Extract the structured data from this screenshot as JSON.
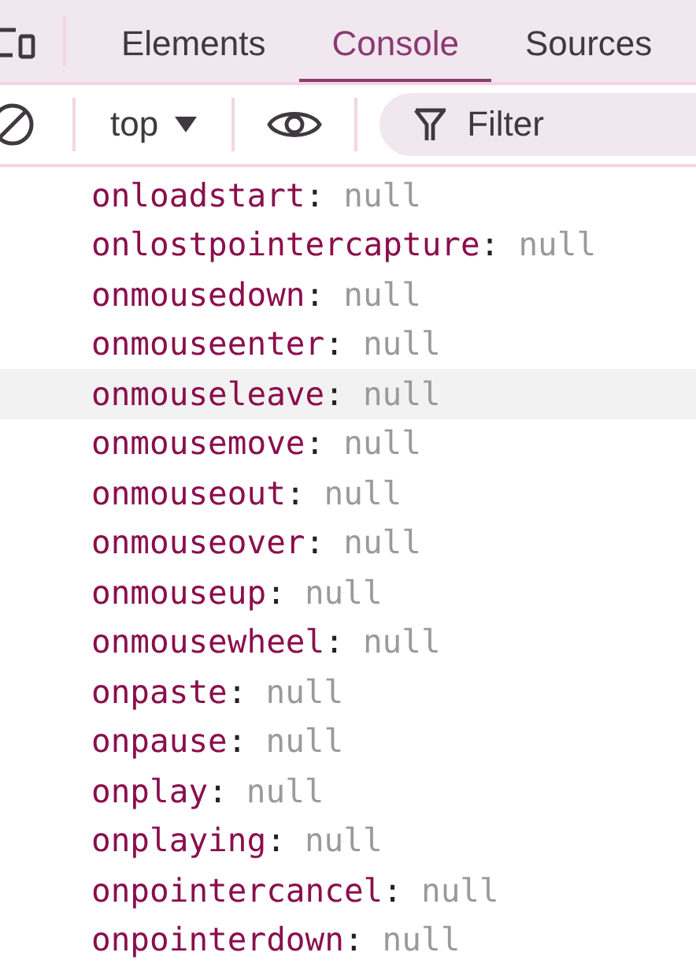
{
  "tabs": [
    {
      "label": "Elements",
      "selected": false
    },
    {
      "label": "Console",
      "selected": true
    },
    {
      "label": "Sources",
      "selected": false
    }
  ],
  "toolbar": {
    "context": "top",
    "filter": {
      "placeholder": "Filter"
    }
  },
  "separator": ":",
  "properties": [
    {
      "name": "onloadstart",
      "value": "null",
      "hovered": false
    },
    {
      "name": "onlostpointercapture",
      "value": "null",
      "hovered": false
    },
    {
      "name": "onmousedown",
      "value": "null",
      "hovered": false
    },
    {
      "name": "onmouseenter",
      "value": "null",
      "hovered": false
    },
    {
      "name": "onmouseleave",
      "value": "null",
      "hovered": true
    },
    {
      "name": "onmousemove",
      "value": "null",
      "hovered": false
    },
    {
      "name": "onmouseout",
      "value": "null",
      "hovered": false
    },
    {
      "name": "onmouseover",
      "value": "null",
      "hovered": false
    },
    {
      "name": "onmouseup",
      "value": "null",
      "hovered": false
    },
    {
      "name": "onmousewheel",
      "value": "null",
      "hovered": false
    },
    {
      "name": "onpaste",
      "value": "null",
      "hovered": false
    },
    {
      "name": "onpause",
      "value": "null",
      "hovered": false
    },
    {
      "name": "onplay",
      "value": "null",
      "hovered": false
    },
    {
      "name": "onplaying",
      "value": "null",
      "hovered": false
    },
    {
      "name": "onpointercancel",
      "value": "null",
      "hovered": false
    },
    {
      "name": "onpointerdown",
      "value": "null",
      "hovered": false
    }
  ]
}
